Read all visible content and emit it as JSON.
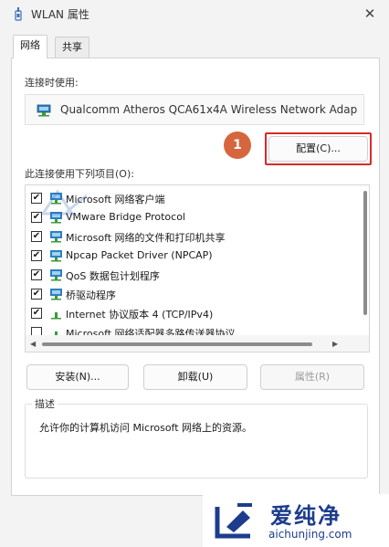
{
  "window": {
    "title": "WLAN 属性",
    "close": "✕"
  },
  "tabs": [
    {
      "label": "网络",
      "active": true
    },
    {
      "label": "共享",
      "active": false
    }
  ],
  "connect_using": {
    "label": "连接时使用:",
    "adapter": "Qualcomm Atheros QCA61x4A Wireless Network Adap"
  },
  "configure_button": "配置(C)...",
  "annotation_marker": "1",
  "items_label": "此连接使用下列项目(O):",
  "items": [
    {
      "label": "Microsoft 网络客户端",
      "checked": true,
      "icon": "network-client-icon"
    },
    {
      "label": "VMware Bridge Protocol",
      "checked": true,
      "icon": "network-protocol-icon"
    },
    {
      "label": "Microsoft 网络的文件和打印机共享",
      "checked": true,
      "icon": "network-service-icon"
    },
    {
      "label": "Npcap Packet Driver (NPCAP)",
      "checked": true,
      "icon": "network-protocol-icon"
    },
    {
      "label": "QoS 数据包计划程序",
      "checked": true,
      "icon": "network-service-icon"
    },
    {
      "label": "桥驱动程序",
      "checked": true,
      "icon": "network-protocol-icon"
    },
    {
      "label": "Internet 协议版本 4 (TCP/IPv4)",
      "checked": true,
      "icon": "protocol-arrow-icon"
    },
    {
      "label": "Microsoft 网络适配器多路传送器协议",
      "checked": false,
      "icon": "protocol-arrow-icon"
    }
  ],
  "buttons": {
    "install": "安装(N)...",
    "uninstall": "卸载(U)",
    "properties": "属性(R)"
  },
  "description": {
    "title": "描述",
    "text": "允许你的计算机访问 Microsoft 网络上的资源。"
  },
  "watermark": {
    "name": "爱纯净",
    "url": "aichunjing.com"
  },
  "colors": {
    "accent": "#d72b2b",
    "marker": "#d6663e",
    "watermark": "#1d3c8c"
  }
}
